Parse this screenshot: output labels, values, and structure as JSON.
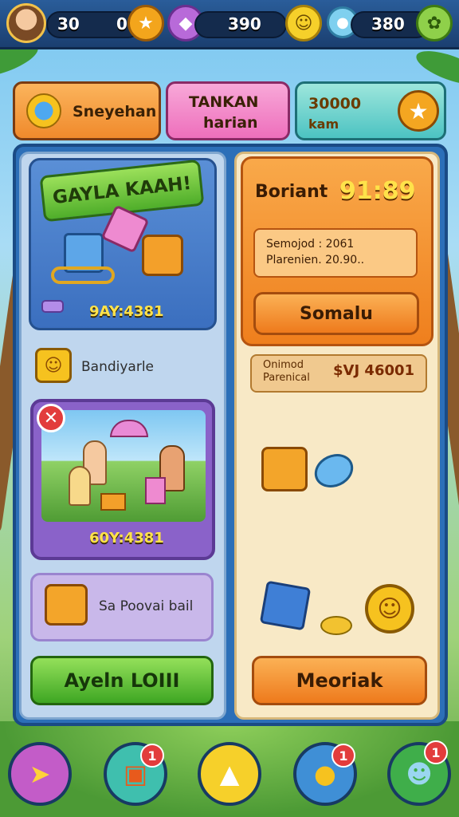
{
  "resources": [
    {
      "value": "30",
      "icon": "avatar-icon"
    },
    {
      "value": "0",
      "icon": "thumbs-up-icon"
    },
    {
      "value": "390",
      "icon": "crystal-icon"
    },
    {
      "value": "380",
      "icon": "smiley-coin-icon"
    }
  ],
  "resource_icon_extra": "speech-bubble-icon",
  "resource_icon_last": "leaf-icon",
  "tabs": [
    {
      "label": "Sneyehan"
    },
    {
      "label_line1": "TANKAN",
      "label_line2": "harian"
    },
    {
      "label_line1": "30000",
      "label_line2": "kam"
    }
  ],
  "left_panel": {
    "banner_title": "GAYLA KAAH!",
    "bundle_price": "9AY:4381",
    "reward_label": "Bandiyarle",
    "scene_price": "60Y:4381",
    "row_label": "Sa Poovai bail",
    "action_button": "Ayeln LOIII"
  },
  "right_panel": {
    "header_title": "Boriant",
    "header_timer": "91:89",
    "info_line1": "Semojod : 2061",
    "info_line2": "Plarenien. 20.90..",
    "mid_button": "Somalu",
    "strip_line1": "Onimod",
    "strip_line2": "Parenical",
    "strip_value": "$VJ 46001",
    "action_button": "Meoriak"
  },
  "nav_badges": [
    "1",
    "1",
    "1"
  ],
  "colors": {
    "topbar": "#1b3f70",
    "accent_orange": "#ef7f1d",
    "accent_green": "#3ea623",
    "badge_red": "#e23c3c"
  }
}
